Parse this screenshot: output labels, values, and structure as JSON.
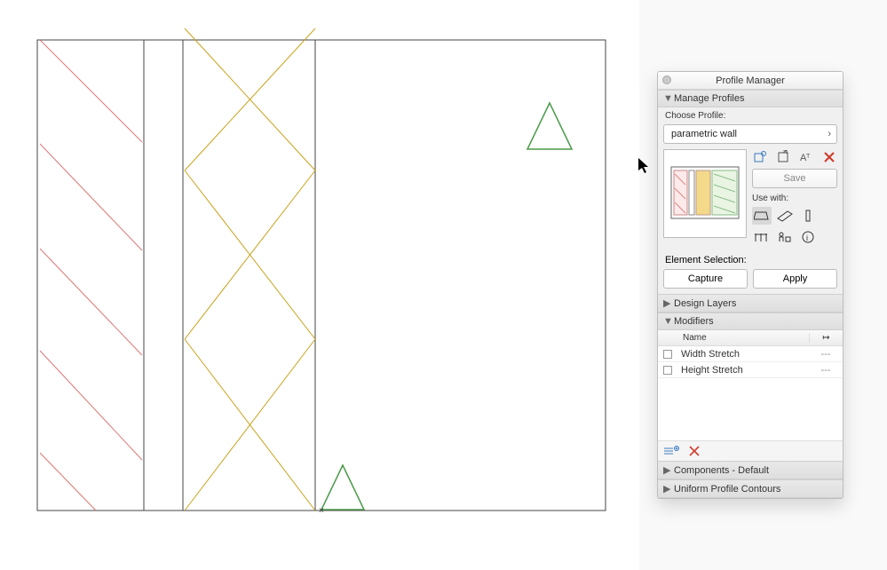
{
  "panel": {
    "title": "Profile Manager",
    "sections": {
      "manageProfiles": "Manage Profiles",
      "designLayers": "Design Layers",
      "modifiers": "Modifiers",
      "componentsDefault": "Components - Default",
      "uniformProfileContours": "Uniform Profile Contours"
    },
    "chooseProfileLabel": "Choose Profile:",
    "profileDropdown": "parametric wall",
    "saveButton": "Save",
    "useWithLabel": "Use with:",
    "elementSelectionLabel": "Element Selection:",
    "captureButton": "Capture",
    "applyButton": "Apply",
    "modifierTable": {
      "headName": "Name",
      "headArrow": "↦",
      "rows": [
        {
          "name": "Width Stretch",
          "value": "---"
        },
        {
          "name": "Height Stretch",
          "value": "---"
        }
      ]
    }
  }
}
